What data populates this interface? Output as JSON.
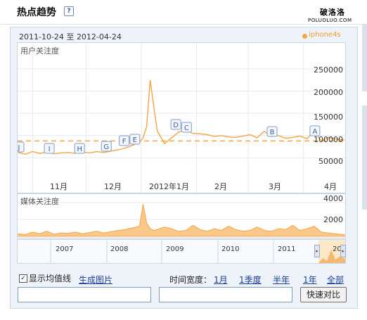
{
  "header": {
    "title": "热点趋势",
    "help_icon": "?"
  },
  "watermark": {
    "line1": "破洛洛",
    "line2": "POLUOLUO.COM"
  },
  "date_range": {
    "start": "2011-10-24",
    "separator": "至",
    "end": "2012-04-24"
  },
  "legend": {
    "series": "iphone4s",
    "color": "#f5a442"
  },
  "user_chart": {
    "label": "用户关注度",
    "y_ticks": [
      "250000",
      "200000",
      "150000",
      "100000",
      "50000"
    ],
    "x_ticks": [
      "11月",
      "12月",
      "2012年1月",
      "2月",
      "3月",
      "4月"
    ]
  },
  "media_chart": {
    "label": "媒体关注度",
    "y_ticks": [
      "4000",
      "2000"
    ]
  },
  "markers": [
    "J",
    "I",
    "H",
    "G",
    "F",
    "E",
    "D",
    "C",
    "B",
    "A"
  ],
  "navigator": {
    "years": [
      "2007",
      "2008",
      "2009",
      "2010",
      "2011",
      "20"
    ]
  },
  "controls": {
    "show_average_label": "显示均值线",
    "show_average_checked": true,
    "generate_image": "生成图片",
    "time_width_label": "时间宽度：",
    "ranges": [
      "1月",
      "1季度",
      "半年",
      "1年",
      "全部"
    ],
    "compare_button": "快速对比"
  },
  "chart_data": {
    "type": "line",
    "title": "用户关注度",
    "series": [
      {
        "name": "iphone4s",
        "color": "#f5a442"
      }
    ],
    "x": [
      "2011-10-24",
      "2011-10-28",
      "2011-11-01",
      "2011-11-05",
      "2011-11-09",
      "2011-11-13",
      "2011-11-17",
      "2011-11-21",
      "2011-11-25",
      "2011-11-29",
      "2011-12-03",
      "2011-12-07",
      "2011-12-11",
      "2011-12-15",
      "2011-12-19",
      "2011-12-23",
      "2011-12-27",
      "2011-12-31",
      "2012-01-02",
      "2012-01-04",
      "2012-01-06",
      "2012-01-08",
      "2012-01-10",
      "2012-01-14",
      "2012-01-18",
      "2012-01-22",
      "2012-01-26",
      "2012-01-30",
      "2012-02-03",
      "2012-02-07",
      "2012-02-11",
      "2012-02-15",
      "2012-02-19",
      "2012-02-23",
      "2012-02-27",
      "2012-03-02",
      "2012-03-06",
      "2012-03-10",
      "2012-03-14",
      "2012-03-18",
      "2012-03-22",
      "2012-03-26",
      "2012-03-30",
      "2012-04-03",
      "2012-04-07",
      "2012-04-11",
      "2012-04-15",
      "2012-04-19",
      "2012-04-24"
    ],
    "values": [
      62000,
      58000,
      64000,
      60000,
      63000,
      59000,
      61000,
      62000,
      60000,
      63000,
      61000,
      64000,
      62000,
      65000,
      68000,
      72000,
      78000,
      85000,
      95000,
      120000,
      225000,
      165000,
      110000,
      82000,
      95000,
      108000,
      112000,
      105000,
      104000,
      102000,
      98000,
      100000,
      97000,
      96000,
      99000,
      102000,
      95000,
      110000,
      98000,
      100000,
      94000,
      96000,
      99000,
      93000,
      110000,
      88000,
      96000,
      92000,
      90000
    ],
    "average": 88000,
    "ylim": [
      0,
      280000
    ],
    "media_series": {
      "name": "iphone4s",
      "values": [
        300,
        200,
        500,
        300,
        600,
        250,
        400,
        350,
        500,
        300,
        450,
        600,
        400,
        550,
        700,
        800,
        1000,
        1200,
        3800,
        1600,
        900,
        700,
        800,
        1100,
        900,
        600,
        700,
        1300,
        800,
        600,
        900,
        700,
        1200,
        800,
        600,
        700,
        1100,
        700,
        600,
        900,
        800,
        1300,
        700,
        900,
        1200,
        500,
        400,
        300,
        200
      ],
      "ylim": [
        0,
        4500
      ]
    }
  }
}
